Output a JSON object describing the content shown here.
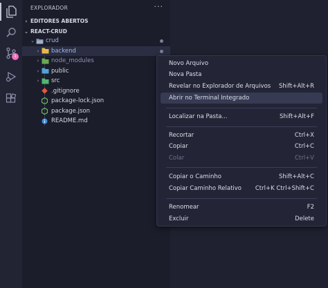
{
  "colors": {
    "accent_folder_backend": "#e6b94f",
    "git_badge": "#ee6fbf",
    "nodemodules_text": "#8f93b5"
  },
  "activity_bar": {
    "scm_badge": "1"
  },
  "sidebar": {
    "title": "EXPLORADOR",
    "more": "···",
    "open_editors": "EDITORES ABERTOS",
    "project": "REACT-CRUD",
    "tree": [
      {
        "label": "crud",
        "icon": "folder-open-icon"
      },
      {
        "label": "backend",
        "icon": "folder-icon"
      },
      {
        "label": "node_modules",
        "icon": "folder-node-icon"
      },
      {
        "label": "public",
        "icon": "folder-public-icon"
      },
      {
        "label": "src",
        "icon": "folder-src-icon"
      },
      {
        "label": ".gitignore",
        "icon": "git-icon"
      },
      {
        "label": "package-lock.json",
        "icon": "node-icon"
      },
      {
        "label": "package.json",
        "icon": "node-icon"
      },
      {
        "label": "README.md",
        "icon": "info-icon"
      }
    ]
  },
  "context_menu": {
    "items": [
      {
        "label": "Novo Arquivo",
        "shortcut": ""
      },
      {
        "label": "Nova Pasta",
        "shortcut": ""
      },
      {
        "label": "Revelar no Explorador de Arquivos",
        "shortcut": "Shift+Alt+R"
      },
      {
        "label": "Abrir no Terminal Integrado",
        "shortcut": ""
      },
      {
        "label": "Localizar na Pasta...",
        "shortcut": "Shift+Alt+F"
      },
      {
        "label": "Recortar",
        "shortcut": "Ctrl+X"
      },
      {
        "label": "Copiar",
        "shortcut": "Ctrl+C"
      },
      {
        "label": "Colar",
        "shortcut": "Ctrl+V"
      },
      {
        "label": "Copiar o Caminho",
        "shortcut": "Shift+Alt+C"
      },
      {
        "label": "Copiar Caminho Relativo",
        "shortcut": "Ctrl+K Ctrl+Shift+C"
      },
      {
        "label": "Renomear",
        "shortcut": "F2"
      },
      {
        "label": "Excluir",
        "shortcut": "Delete"
      }
    ]
  }
}
